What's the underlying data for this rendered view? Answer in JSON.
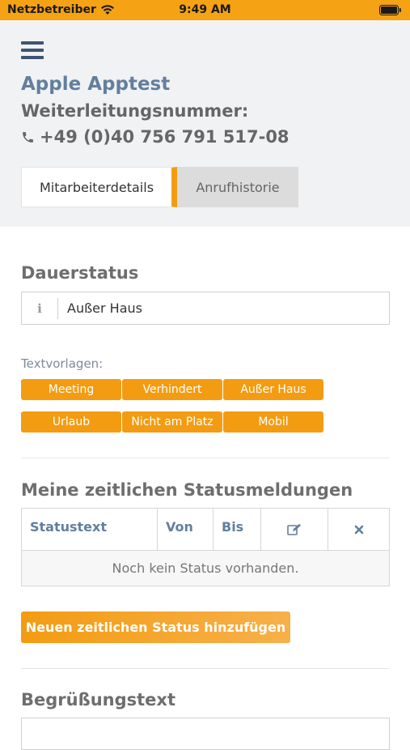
{
  "statusbar": {
    "carrier": "Netzbetreiber",
    "time": "9:49 AM"
  },
  "header": {
    "company": "Apple Apptest",
    "forward_title": "Weiterleitungsnummer:",
    "forward_number": "+49 (0)40 756 791 517-08",
    "tabs": [
      {
        "label": "Mitarbeiterdetails",
        "active": true
      },
      {
        "label": "Anrufhistorie",
        "active": false
      }
    ]
  },
  "dauerstatus": {
    "title": "Dauerstatus",
    "value": "Außer Haus"
  },
  "textvorlagen": {
    "label": "Textvorlagen:",
    "buttons": [
      "Meeting",
      "Verhindert",
      "Außer Haus",
      "Urlaub",
      "Nicht am Platz",
      "Mobil"
    ]
  },
  "statusmeldungen": {
    "title": "Meine zeitlichen Statusmeldungen",
    "columns": [
      "Statustext",
      "Von",
      "Bis"
    ],
    "empty_text": "Noch kein Status vorhanden.",
    "add_button": "Neuen zeitlichen Status hinzufügen"
  },
  "begruessung": {
    "title": "Begrüßungstext"
  },
  "colors": {
    "accent": "#f39c12",
    "brand_blue": "#637f9e",
    "menu": "#3d5573",
    "header_bg": "#f1f2f4"
  },
  "icons": [
    "wifi-icon",
    "battery-icon",
    "menu-icon",
    "phone-icon",
    "info-icon",
    "edit-icon",
    "close-icon"
  ]
}
